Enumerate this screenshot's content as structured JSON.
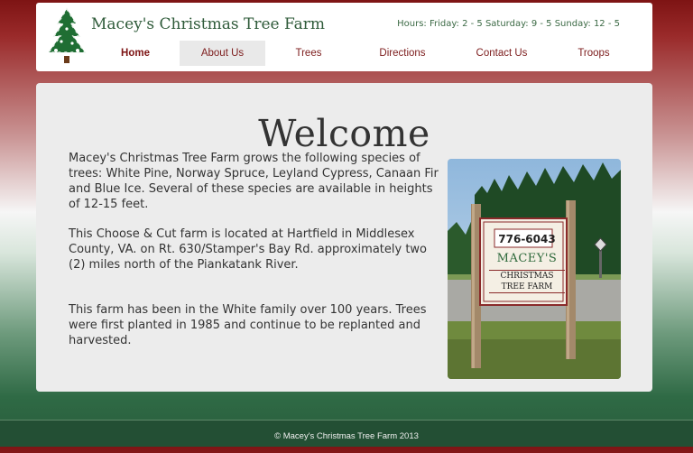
{
  "header": {
    "site_title": "Macey's Christmas Tree Farm",
    "hours": "Hours: Friday: 2 - 5 Saturday: 9 - 5 Sunday: 12 - 5"
  },
  "nav": {
    "items": [
      {
        "label": "Home"
      },
      {
        "label": "About Us"
      },
      {
        "label": "Trees"
      },
      {
        "label": "Directions"
      },
      {
        "label": "Contact Us"
      },
      {
        "label": "Troops"
      }
    ]
  },
  "main": {
    "heading": "Welcome",
    "paragraphs": [
      "Macey's Christmas Tree Farm grows the following species of trees: White Pine, Norway Spruce, Leyland Cypress, Canaan Fir and Blue Ice. Several of these species are available in heights of 12-15 feet.",
      "This Choose & Cut farm is located at Hartfield in Middlesex County, VA. on Rt. 630/Stamper's Bay Rd. approximately two (2) miles north of the Piankatank River.",
      "This farm has been in the White family over 100 years. Trees were first planted in 1985 and continue to be replanted and harvested."
    ],
    "sign": {
      "phone": "776-6043",
      "name": "MACEY'S",
      "line1": "CHRISTMAS",
      "line2": "TREE FARM"
    }
  },
  "footer": {
    "copyright": "© Macey's Christmas Tree Farm 2013"
  },
  "colors": {
    "nav_text": "#7d1d1d",
    "title_green": "#2f5b3a",
    "footer_bg": "#234f34"
  }
}
